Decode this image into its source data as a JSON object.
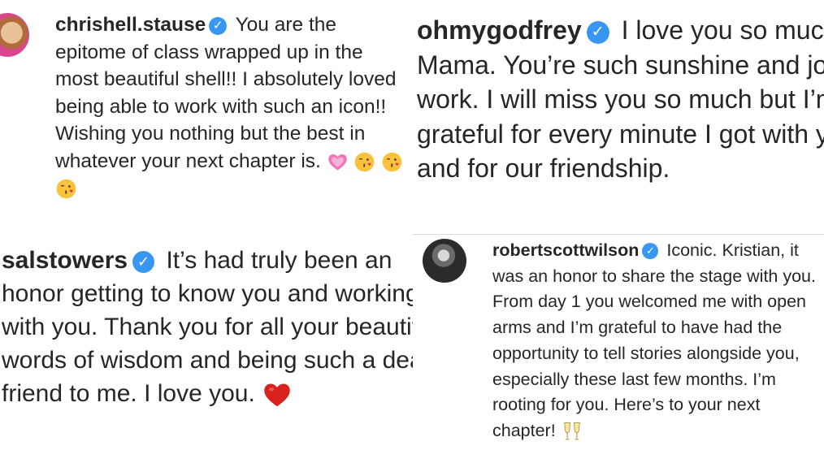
{
  "comments": [
    {
      "username": "chrishell.stause",
      "text": "You are the epitome of class wrapped up in the most beautiful shell!! I absolutely loved being able to work with such an icon!! Wishing you nothing but the best in whatever your next chapter is.",
      "emojis": [
        "pink-heart-emoji",
        "kissing-face-emoji",
        "kissing-face-emoji",
        "kissing-face-emoji"
      ]
    },
    {
      "username": "ohmygodfrey",
      "text": "I love you so much, Mama. You’re such sunshine and joy at work. I will miss you so much but I’m grateful for every minute I got with you and for our friendship."
    },
    {
      "username": "salstowers",
      "text": "It’s had truly been an honor getting to know you and working with you. Thank you for all your beautiful words of wisdom and being such a dear friend to me. I love you.",
      "emojis": [
        "red-heart-emoji"
      ]
    },
    {
      "username": "robertscottwilson",
      "text": "Iconic. Kristian, it was an honor to share the stage with you. From day 1 you welcomed me with open arms and I’m grateful to have had the opportunity to tell stories alongside you, especially these last few months. I’m rooting for you. Here’s to your next chapter!",
      "emojis": [
        "clinking-glasses-emoji"
      ]
    }
  ],
  "badge": {
    "icon": "verified-badge-icon",
    "glyph": "✓",
    "color": "#3897f0"
  }
}
